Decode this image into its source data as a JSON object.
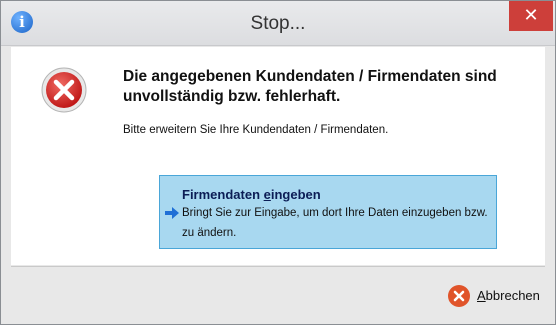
{
  "window": {
    "title": "Stop...",
    "close_glyph": "✕",
    "icon": "info-icon"
  },
  "content": {
    "heading": "Die angegebenen Kundendaten / Firmendaten sind unvollständig bzw. fehlerhaft.",
    "message": "Bitte erweitern Sie Ihre Kundendaten / Firmendaten.",
    "icon": "error-icon"
  },
  "command_link": {
    "title_pre": "Firmendaten ",
    "title_access": "e",
    "title_post": "ingeben",
    "description": "Bringt Sie zur Eingabe, um dort Ihre Daten einzugeben bzw. zu ändern.",
    "icon": "arrow-right-icon"
  },
  "footer": {
    "cancel_access": "A",
    "cancel_rest": "bbrechen",
    "icon": "cancel-icon"
  },
  "colors": {
    "close_button": "#cd3f3a",
    "command_link_bg": "#a8d8f0",
    "command_link_border": "#4aa6d8",
    "error_red": "#d8272b"
  }
}
